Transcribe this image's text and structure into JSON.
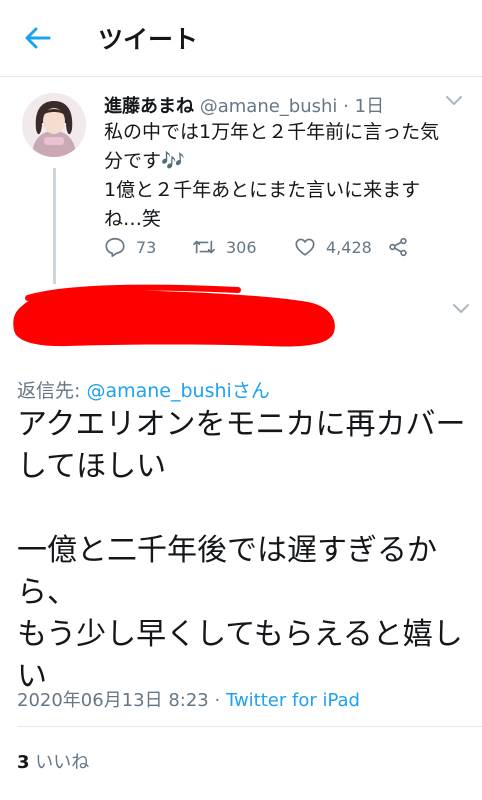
{
  "header": {
    "title": "ツイート"
  },
  "parent_tweet": {
    "author_name": "進藤あまね",
    "handle": "@amane_bushi",
    "separator": "·",
    "time": "1日",
    "lines": [
      "私の中では1万年と２千年前に言った気",
      "分です🎶",
      "1億と２千年あとにまた言いに来ます",
      "ね…笑"
    ],
    "replies": "73",
    "retweets": "306",
    "likes": "4,428"
  },
  "tweet": {
    "reply_label": "返信先: ",
    "reply_mention": "@amane_bushi",
    "reply_suffix": "さん",
    "lines": [
      "アクエリオンをモニカに再カバー",
      "してほしい",
      "",
      "一億と二千年後では遅すぎるか",
      "ら、",
      "もう少し早くしてもらえると嬉し",
      "い"
    ],
    "date": "2020年06月13日 8:23",
    "separator": " · ",
    "source": "Twitter for iPad",
    "like_count": "3",
    "like_label": " いいね"
  },
  "colors": {
    "accent": "#1da1f2",
    "secondary_text": "#657786",
    "redaction": "#ff0000"
  }
}
